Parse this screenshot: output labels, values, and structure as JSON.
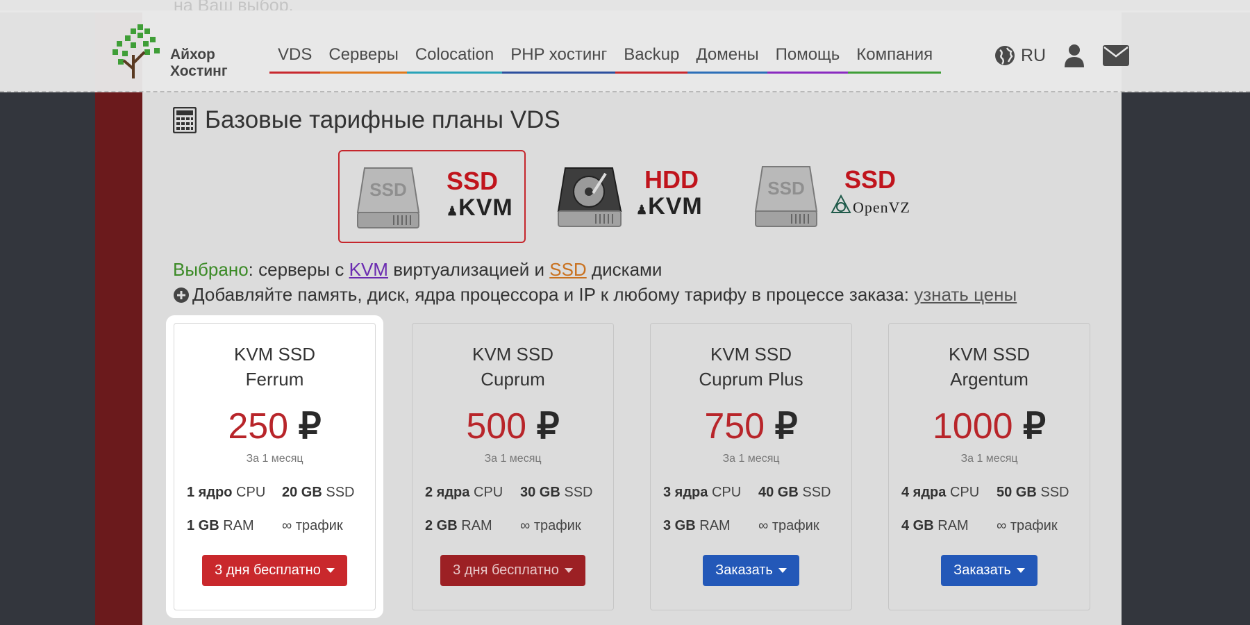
{
  "top_partial_text": "на Ваш выбор.",
  "logo": {
    "line1": "Айхор",
    "line2": "Хостинг"
  },
  "nav": [
    {
      "label": "VDS",
      "color": "#c8282e"
    },
    {
      "label": "Серверы",
      "color": "#e07a1c"
    },
    {
      "label": "Colocation",
      "color": "#29a3b8"
    },
    {
      "label": "PHP хостинг",
      "color": "#2c4f9e"
    },
    {
      "label": "Backup",
      "color": "#c8282e"
    },
    {
      "label": "Домены",
      "color": "#2c6fb8"
    },
    {
      "label": "Помощь",
      "color": "#8a2bc0"
    },
    {
      "label": "Компания",
      "color": "#3f9e37"
    }
  ],
  "lang": "RU",
  "title": "Базовые тарифные планы VDS",
  "types": [
    {
      "main": "SSD",
      "sub": "KVM",
      "selected": true
    },
    {
      "main": "HDD",
      "sub": "KVM",
      "selected": false
    },
    {
      "main": "SSD",
      "sub": "OpenVZ",
      "selected": false
    }
  ],
  "selection": {
    "label": "Выбрано",
    "text1": ": серверы с ",
    "kvm": "KVM",
    "text2": " виртуализацией и ",
    "ssd": "SSD",
    "text3": " дисками"
  },
  "addons": {
    "text": "Добавляйте память, диск, ядра процессора и IP к любому тарифу в процессе заказа: ",
    "link": "узнать цены"
  },
  "plans": [
    {
      "line1": "KVM SSD",
      "line2": "Ferrum",
      "price": "250",
      "currency": "₽",
      "period": "За 1 месяц",
      "cpu_b": "1 ядро",
      "cpu": " CPU",
      "disk_b": "20 GB",
      "disk": " SSD",
      "ram_b": "1 GB",
      "ram": " RAM",
      "traffic": "∞ трафик",
      "button": "3 дня бесплатно",
      "button_style": "red",
      "active": true
    },
    {
      "line1": "KVM SSD",
      "line2": "Cuprum",
      "price": "500",
      "currency": "₽",
      "period": "За 1 месяц",
      "cpu_b": "2 ядра",
      "cpu": " CPU",
      "disk_b": "30 GB",
      "disk": " SSD",
      "ram_b": "2 GB",
      "ram": " RAM",
      "traffic": "∞ трафик",
      "button": "3 дня бесплатно",
      "button_style": "red dim",
      "active": false
    },
    {
      "line1": "KVM SSD",
      "line2": "Cuprum Plus",
      "price": "750",
      "currency": "₽",
      "period": "За 1 месяц",
      "cpu_b": "3 ядра",
      "cpu": " CPU",
      "disk_b": "40 GB",
      "disk": " SSD",
      "ram_b": "3 GB",
      "ram": " RAM",
      "traffic": "∞ трафик",
      "button": "Заказать",
      "button_style": "blue",
      "active": false
    },
    {
      "line1": "KVM SSD",
      "line2": "Argentum",
      "price": "1000",
      "currency": "₽",
      "period": "За 1 месяц",
      "cpu_b": "4 ядра",
      "cpu": " CPU",
      "disk_b": "50 GB",
      "disk": " SSD",
      "ram_b": "4 GB",
      "ram": " RAM",
      "traffic": "∞ трафик",
      "button": "Заказать",
      "button_style": "blue",
      "active": false
    }
  ]
}
